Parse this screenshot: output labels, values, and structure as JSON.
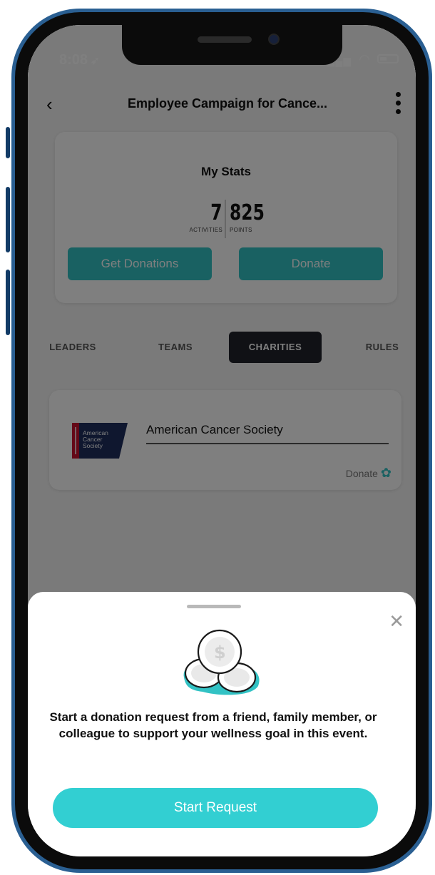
{
  "status": {
    "time": "8:08"
  },
  "nav": {
    "title": "Employee Campaign for Cance..."
  },
  "stats": {
    "heading": "My Stats",
    "activities_value": "7",
    "activities_label": "ACTIVITIES",
    "points_value": "825",
    "points_label": "POINTS",
    "get_donations_label": "Get Donations",
    "donate_label": "Donate"
  },
  "tabs": [
    "LEADERS",
    "TEAMS",
    "CHARITIES",
    "RULES"
  ],
  "active_tab": "CHARITIES",
  "charity": {
    "name": "American Cancer Society",
    "donate_label": "Donate",
    "logo_text": [
      "American",
      "Cancer",
      "Society"
    ]
  },
  "sheet": {
    "message": "Start a donation request from a friend, family member, or colleague to support your wellness goal in this event.",
    "start_button": "Start Request"
  },
  "colors": {
    "accent": "#32c2c4",
    "tab_active": "#20232a",
    "phone_frame": "#2a5f92"
  },
  "icons": [
    "back-chevron-icon",
    "more-vertical-icon",
    "signal-icon",
    "wifi-icon",
    "battery-icon",
    "donate-hand-icon",
    "close-icon",
    "coins-illustration"
  ]
}
